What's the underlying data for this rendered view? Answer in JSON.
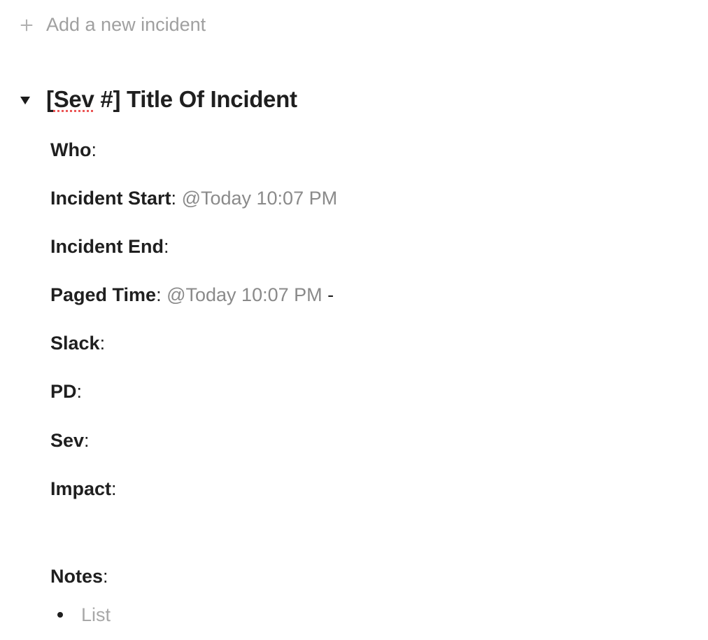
{
  "add_incident": {
    "label": "Add a new incident"
  },
  "incident": {
    "title_prefix": "[",
    "title_spell": "Sev",
    "title_rest": " #] Title Of Incident",
    "fields": {
      "who_label": "Who",
      "incident_start_label": "Incident Start",
      "incident_start_value": "@Today 10:07 PM",
      "incident_end_label": "Incident End",
      "paged_time_label": "Paged Time",
      "paged_time_value": "@Today 10:07 PM",
      "paged_time_trailing": " -",
      "slack_label": "Slack",
      "pd_label": "PD",
      "sev_label": "Sev",
      "impact_label": "Impact"
    },
    "notes": {
      "label": "Notes",
      "placeholder": "List"
    }
  }
}
